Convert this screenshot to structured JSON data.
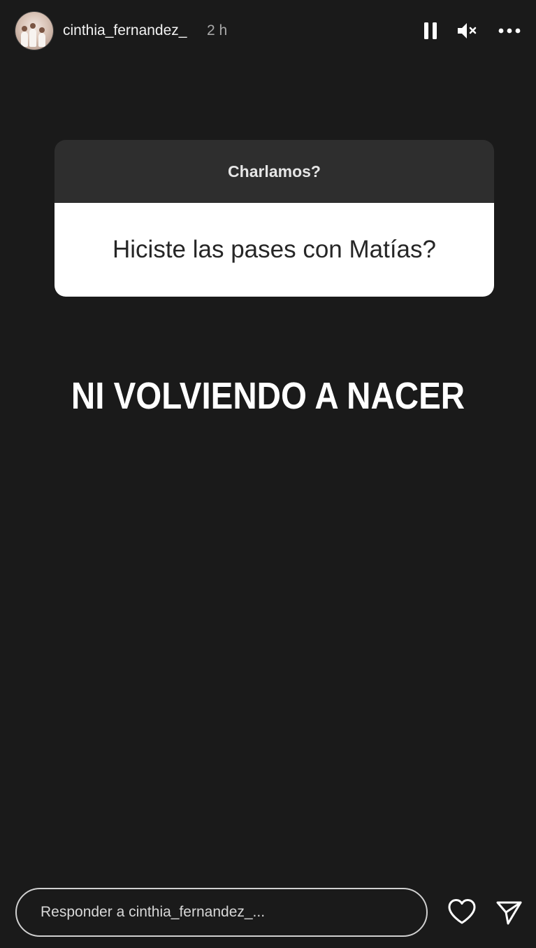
{
  "header": {
    "username": "cinthia_fernandez_",
    "timestamp": "2 h",
    "icons": {
      "pause": "pause-icon",
      "mute": "muted-speaker-icon",
      "more": "more-options-icon"
    }
  },
  "sticker": {
    "prompt": "Charlamos?",
    "question": "Hiciste las pases con Matías?"
  },
  "answer_text": "NI VOLVIENDO A NACER",
  "footer": {
    "reply_placeholder": "Responder a cinthia_fernandez_...",
    "icons": {
      "like": "heart-icon",
      "send": "send-icon"
    }
  },
  "colors": {
    "background": "#1a1a1a",
    "sticker_header": "#2e2e2e",
    "sticker_body": "#ffffff",
    "text_primary": "#ffffff",
    "text_muted": "#a8a8a8"
  }
}
